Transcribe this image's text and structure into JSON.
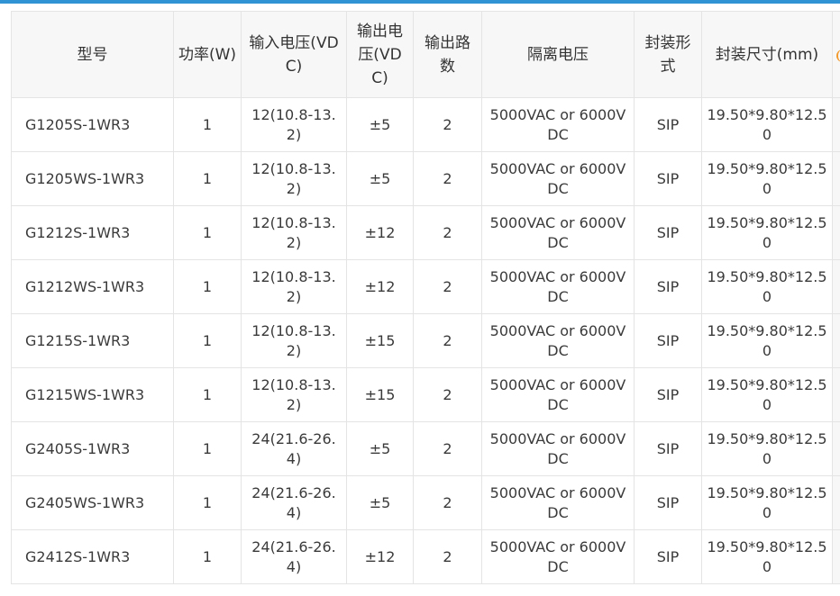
{
  "table": {
    "headers": {
      "model": "型号",
      "power": "功率(W)",
      "input_voltage": "输入电压(VDC)",
      "output_voltage": "输出电压(VDC)",
      "channels": "输出路数",
      "isolation": "隔离电压",
      "package": "封装形式",
      "size": "封装尺寸(mm)"
    },
    "rows": [
      {
        "model": "G1205S-1WR3",
        "power": "1",
        "input_voltage": "12(10.8-13.2)",
        "output_voltage": "±5",
        "channels": "2",
        "isolation": "5000VAC or 6000VDC",
        "package": "SIP",
        "size": "19.50*9.80*12.50"
      },
      {
        "model": "G1205WS-1WR3",
        "power": "1",
        "input_voltage": "12(10.8-13.2)",
        "output_voltage": "±5",
        "channels": "2",
        "isolation": "5000VAC or 6000VDC",
        "package": "SIP",
        "size": "19.50*9.80*12.50"
      },
      {
        "model": "G1212S-1WR3",
        "power": "1",
        "input_voltage": "12(10.8-13.2)",
        "output_voltage": "±12",
        "channels": "2",
        "isolation": "5000VAC or 6000VDC",
        "package": "SIP",
        "size": "19.50*9.80*12.50"
      },
      {
        "model": "G1212WS-1WR3",
        "power": "1",
        "input_voltage": "12(10.8-13.2)",
        "output_voltage": "±12",
        "channels": "2",
        "isolation": "5000VAC or 6000VDC",
        "package": "SIP",
        "size": "19.50*9.80*12.50"
      },
      {
        "model": "G1215S-1WR3",
        "power": "1",
        "input_voltage": "12(10.8-13.2)",
        "output_voltage": "±15",
        "channels": "2",
        "isolation": "5000VAC or 6000VDC",
        "package": "SIP",
        "size": "19.50*9.80*12.50"
      },
      {
        "model": "G1215WS-1WR3",
        "power": "1",
        "input_voltage": "12(10.8-13.2)",
        "output_voltage": "±15",
        "channels": "2",
        "isolation": "5000VAC or 6000VDC",
        "package": "SIP",
        "size": "19.50*9.80*12.50"
      },
      {
        "model": "G2405S-1WR3",
        "power": "1",
        "input_voltage": "24(21.6-26.4)",
        "output_voltage": "±5",
        "channels": "2",
        "isolation": "5000VAC or 6000VDC",
        "package": "SIP",
        "size": "19.50*9.80*12.50"
      },
      {
        "model": "G2405WS-1WR3",
        "power": "1",
        "input_voltage": "24(21.6-26.4)",
        "output_voltage": "±5",
        "channels": "2",
        "isolation": "5000VAC or 6000VDC",
        "package": "SIP",
        "size": "19.50*9.80*12.50"
      },
      {
        "model": "G2412S-1WR3",
        "power": "1",
        "input_voltage": "24(21.6-26.4)",
        "output_voltage": "±12",
        "channels": "2",
        "isolation": "5000VAC or 6000VDC",
        "package": "SIP",
        "size": "19.50*9.80*12.50"
      }
    ]
  },
  "colors": {
    "accent_bar": "#2f93d4",
    "header_bg": "#f7f7f7",
    "border": "#e4e4e4",
    "partial_icon": "#f39a2b"
  }
}
